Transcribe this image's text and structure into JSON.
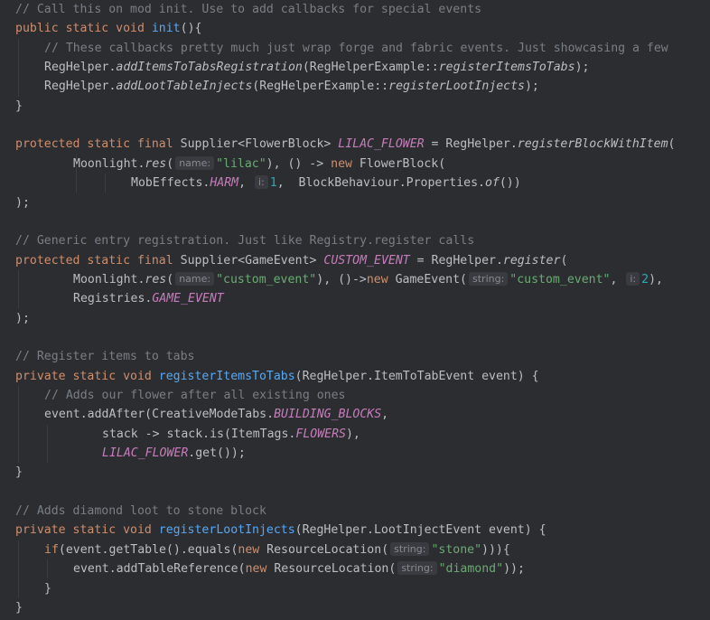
{
  "editor": {
    "language": "java",
    "theme_colors": {
      "background": "#2b2d30",
      "comment": "#7a7e85",
      "keyword": "#cf8e6d",
      "constant": "#c77dbb",
      "method_declaration": "#56a8f5",
      "string": "#6aab73",
      "number": "#2aacb8",
      "default": "#bcbec4",
      "hint_bg": "#393b40",
      "hint_fg": "#868a91"
    },
    "lines": [
      {
        "tokens": [
          {
            "t": "// Call this on mod init. Use to add callbacks for special events",
            "c": "comment"
          }
        ]
      },
      {
        "tokens": [
          {
            "t": "public static void ",
            "c": "kw"
          },
          {
            "t": "init",
            "c": "method"
          },
          {
            "t": "(){",
            "c": "brace"
          }
        ]
      },
      {
        "indent": 4,
        "tokens": [
          {
            "t": "// These callbacks pretty much just wrap forge and fabric events. Just showcasing a few",
            "c": "comment"
          }
        ]
      },
      {
        "indent": 4,
        "tokens": [
          {
            "t": "RegHelper.",
            "c": "type"
          },
          {
            "t": "addItemsToTabsRegistration",
            "c": "staticcall"
          },
          {
            "t": "(RegHelperExample::",
            "c": "type"
          },
          {
            "t": "registerItemsToTabs",
            "c": "staticcall"
          },
          {
            "t": ");",
            "c": "type"
          }
        ]
      },
      {
        "indent": 4,
        "tokens": [
          {
            "t": "RegHelper.",
            "c": "type"
          },
          {
            "t": "addLootTableInjects",
            "c": "staticcall"
          },
          {
            "t": "(RegHelperExample::",
            "c": "type"
          },
          {
            "t": "registerLootInjects",
            "c": "staticcall"
          },
          {
            "t": ");",
            "c": "type"
          }
        ]
      },
      {
        "tokens": [
          {
            "t": "}",
            "c": "brace"
          }
        ]
      },
      {
        "tokens": []
      },
      {
        "tokens": [
          {
            "t": "protected static final ",
            "c": "kw"
          },
          {
            "t": "Supplier<FlowerBlock> ",
            "c": "type"
          },
          {
            "t": "LILAC_FLOWER",
            "c": "fieldconst"
          },
          {
            "t": " = RegHelper.",
            "c": "type"
          },
          {
            "t": "registerBlockWithItem",
            "c": "staticcall"
          },
          {
            "t": "(",
            "c": "type"
          }
        ]
      },
      {
        "indent": 8,
        "tokens": [
          {
            "t": "Moonlight.",
            "c": "type"
          },
          {
            "t": "res",
            "c": "staticcall"
          },
          {
            "t": "(",
            "c": "type"
          },
          {
            "hint": "name:"
          },
          {
            "t": "\"lilac\"",
            "c": "string"
          },
          {
            "t": "), () -> ",
            "c": "type"
          },
          {
            "t": "new ",
            "c": "kw"
          },
          {
            "t": "FlowerBlock(",
            "c": "type"
          }
        ]
      },
      {
        "indent": 16,
        "tokens": [
          {
            "t": "MobEffects.",
            "c": "type"
          },
          {
            "t": "HARM",
            "c": "fieldconst"
          },
          {
            "t": ", ",
            "c": "type"
          },
          {
            "hint": "i:"
          },
          {
            "t": "1",
            "c": "number"
          },
          {
            "t": ",  BlockBehaviour.Properties.",
            "c": "type"
          },
          {
            "t": "of",
            "c": "staticcall"
          },
          {
            "t": "())",
            "c": "type"
          }
        ]
      },
      {
        "tokens": [
          {
            "t": ");",
            "c": "type"
          }
        ]
      },
      {
        "tokens": []
      },
      {
        "tokens": [
          {
            "t": "// Generic entry registration. Just like Registry.register calls",
            "c": "comment"
          }
        ]
      },
      {
        "tokens": [
          {
            "t": "protected static final ",
            "c": "kw"
          },
          {
            "t": "Supplier<GameEvent> ",
            "c": "type"
          },
          {
            "t": "CUSTOM_EVENT",
            "c": "fieldconst"
          },
          {
            "t": " = RegHelper.",
            "c": "type"
          },
          {
            "t": "register",
            "c": "staticcall"
          },
          {
            "t": "(",
            "c": "type"
          }
        ]
      },
      {
        "indent": 8,
        "tokens": [
          {
            "t": "Moonlight.",
            "c": "type"
          },
          {
            "t": "res",
            "c": "staticcall"
          },
          {
            "t": "(",
            "c": "type"
          },
          {
            "hint": "name:"
          },
          {
            "t": "\"custom_event\"",
            "c": "string"
          },
          {
            "t": "), ()->",
            "c": "type"
          },
          {
            "t": "new ",
            "c": "kw"
          },
          {
            "t": "GameEvent(",
            "c": "type"
          },
          {
            "hint": "string:"
          },
          {
            "t": "\"custom_event\"",
            "c": "string"
          },
          {
            "t": ", ",
            "c": "type"
          },
          {
            "hint": "i:"
          },
          {
            "t": "2",
            "c": "number"
          },
          {
            "t": "),",
            "c": "type"
          }
        ]
      },
      {
        "indent": 8,
        "tokens": [
          {
            "t": "Registries.",
            "c": "type"
          },
          {
            "t": "GAME_EVENT",
            "c": "fieldconst"
          }
        ]
      },
      {
        "tokens": [
          {
            "t": ");",
            "c": "type"
          }
        ]
      },
      {
        "tokens": []
      },
      {
        "tokens": [
          {
            "t": "// Register items to tabs",
            "c": "comment"
          }
        ]
      },
      {
        "tokens": [
          {
            "t": "private static void ",
            "c": "kw"
          },
          {
            "t": "registerItemsToTabs",
            "c": "method"
          },
          {
            "t": "(RegHelper.ItemToTabEvent event) {",
            "c": "type"
          }
        ]
      },
      {
        "indent": 4,
        "tokens": [
          {
            "t": "// Adds our flower after all existing ones",
            "c": "comment"
          }
        ]
      },
      {
        "indent": 4,
        "tokens": [
          {
            "t": "event.addAfter(CreativeModeTabs.",
            "c": "type"
          },
          {
            "t": "BUILDING_BLOCKS",
            "c": "fieldconst"
          },
          {
            "t": ",",
            "c": "type"
          }
        ]
      },
      {
        "indent": 12,
        "tokens": [
          {
            "t": "stack -> stack.is(ItemTags.",
            "c": "type"
          },
          {
            "t": "FLOWERS",
            "c": "fieldconst"
          },
          {
            "t": "),",
            "c": "type"
          }
        ]
      },
      {
        "indent": 12,
        "tokens": [
          {
            "t": "LILAC_FLOWER",
            "c": "fieldconst"
          },
          {
            "t": ".get());",
            "c": "type"
          }
        ]
      },
      {
        "tokens": [
          {
            "t": "}",
            "c": "brace"
          }
        ]
      },
      {
        "tokens": []
      },
      {
        "tokens": [
          {
            "t": "// Adds diamond loot to stone block",
            "c": "comment"
          }
        ]
      },
      {
        "tokens": [
          {
            "t": "private static void ",
            "c": "kw"
          },
          {
            "t": "registerLootInjects",
            "c": "method"
          },
          {
            "t": "(RegHelper.LootInjectEvent event) {",
            "c": "type"
          }
        ]
      },
      {
        "indent": 4,
        "tokens": [
          {
            "t": "if",
            "c": "kw"
          },
          {
            "t": "(event.getTable().equals(",
            "c": "type"
          },
          {
            "t": "new ",
            "c": "kw"
          },
          {
            "t": "ResourceLocation(",
            "c": "type"
          },
          {
            "hint": "string:"
          },
          {
            "t": "\"stone\"",
            "c": "string"
          },
          {
            "t": "))){",
            "c": "type"
          }
        ]
      },
      {
        "indent": 8,
        "tokens": [
          {
            "t": "event.addTableReference(",
            "c": "type"
          },
          {
            "t": "new ",
            "c": "kw"
          },
          {
            "t": "ResourceLocation(",
            "c": "type"
          },
          {
            "hint": "string:"
          },
          {
            "t": "\"diamond\"",
            "c": "string"
          },
          {
            "t": "));",
            "c": "type"
          }
        ]
      },
      {
        "indent": 4,
        "tokens": [
          {
            "t": "}",
            "c": "brace"
          }
        ]
      },
      {
        "tokens": [
          {
            "t": "}",
            "c": "brace"
          }
        ]
      }
    ]
  }
}
